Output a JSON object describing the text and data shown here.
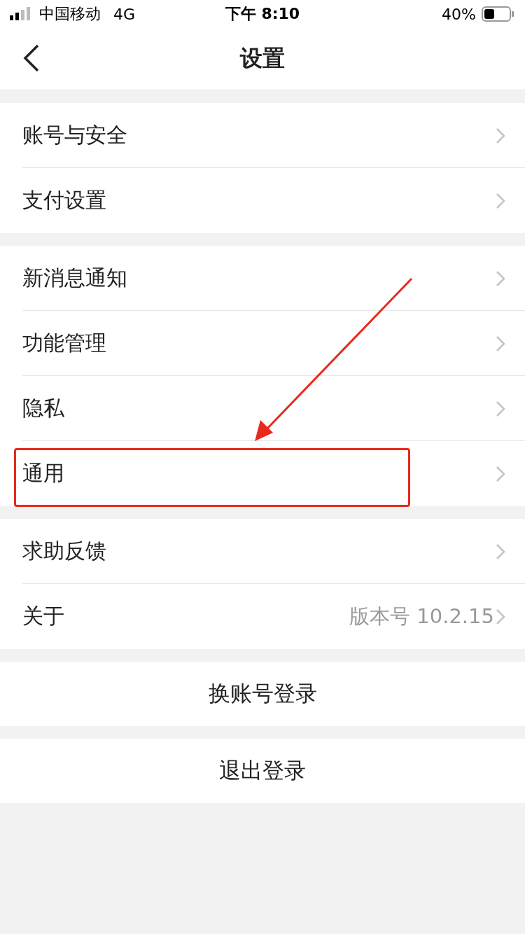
{
  "status_bar": {
    "carrier": "中国移动",
    "network": "4G",
    "time": "下午 8:10",
    "battery": "40%"
  },
  "nav": {
    "title": "设置"
  },
  "groups": [
    {
      "items": [
        {
          "label": "账号与安全",
          "highlighted": false
        },
        {
          "label": "支付设置",
          "highlighted": false
        }
      ]
    },
    {
      "items": [
        {
          "label": "新消息通知",
          "highlighted": false
        },
        {
          "label": "功能管理",
          "highlighted": false
        },
        {
          "label": "隐私",
          "highlighted": false
        },
        {
          "label": "通用",
          "highlighted": true
        }
      ]
    },
    {
      "items": [
        {
          "label": "求助反馈",
          "highlighted": false
        },
        {
          "label": "关于",
          "value": "版本号 10.2.15",
          "highlighted": false
        }
      ]
    }
  ],
  "actions": [
    "换账号登录",
    "退出登录"
  ]
}
